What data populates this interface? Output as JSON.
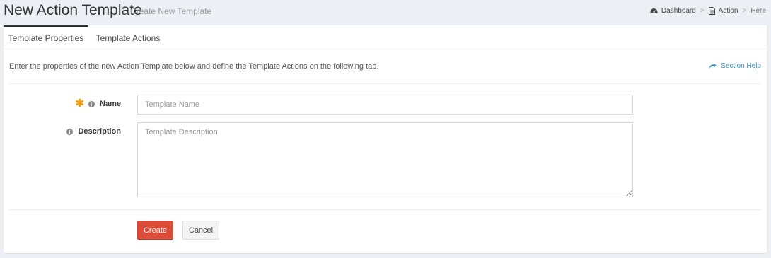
{
  "header": {
    "title": "New Action Template",
    "subtitle": "Create New Template"
  },
  "breadcrumb": {
    "items": [
      {
        "label": "Dashboard",
        "icon": "dashboard-icon"
      },
      {
        "label": "Action",
        "icon": "file-icon"
      },
      {
        "label": "Here"
      }
    ],
    "separator": ">"
  },
  "tabs": [
    {
      "label": "Template Properties",
      "active": true
    },
    {
      "label": "Template Actions",
      "active": false
    }
  ],
  "intro_text": "Enter the properties of the new Action Template below and define the Template Actions on the following tab.",
  "section_help": {
    "label": "Section Help",
    "icon": "share-icon"
  },
  "form": {
    "name": {
      "label": "Name",
      "required": true,
      "placeholder": "Template Name",
      "value": ""
    },
    "description": {
      "label": "Description",
      "required": false,
      "placeholder": "Template Description",
      "value": ""
    }
  },
  "actions": {
    "create_label": "Create",
    "cancel_label": "Cancel"
  },
  "colors": {
    "primary_danger": "#dd4b39",
    "link": "#3c8dbc",
    "required_star": "#f39c12",
    "background": "#ecf0f5"
  }
}
